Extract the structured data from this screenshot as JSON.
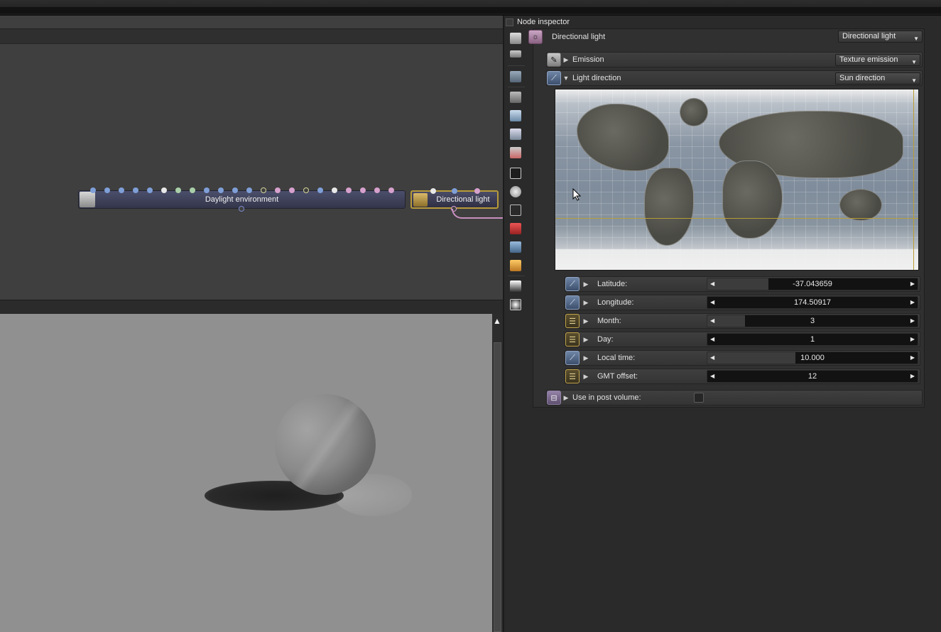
{
  "inspector": {
    "title": "Node inspector",
    "node_name": "Directional light",
    "node_type": "Directional light"
  },
  "graph": {
    "nodes": [
      {
        "label": "Daylight environment"
      },
      {
        "label": "Directional light"
      }
    ]
  },
  "sections": {
    "emission": {
      "label": "Emission",
      "value": "Texture emission"
    },
    "light_direction": {
      "label": "Light direction",
      "value": "Sun direction"
    },
    "use_in_post_volume": {
      "label": "Use in post volume:",
      "checked": false
    }
  },
  "params": [
    {
      "label": "Latitude:",
      "value": "-37.043659",
      "fraction": 0.29,
      "kind": "float"
    },
    {
      "label": "Longitude:",
      "value": "174.50917",
      "fraction": 0.0,
      "kind": "float"
    },
    {
      "label": "Month:",
      "value": "3",
      "fraction": 0.18,
      "kind": "int"
    },
    {
      "label": "Day:",
      "value": "1",
      "fraction": 0.0,
      "kind": "int"
    },
    {
      "label": "Local time:",
      "value": "10.000",
      "fraction": 0.42,
      "kind": "float"
    },
    {
      "label": "GMT offset:",
      "value": "12",
      "fraction": 0.0,
      "kind": "int"
    }
  ],
  "colors": {
    "accent_gold": "#b79a3a",
    "node_blue": "#4c4f6b",
    "wire_pink": "#c98fc0"
  }
}
